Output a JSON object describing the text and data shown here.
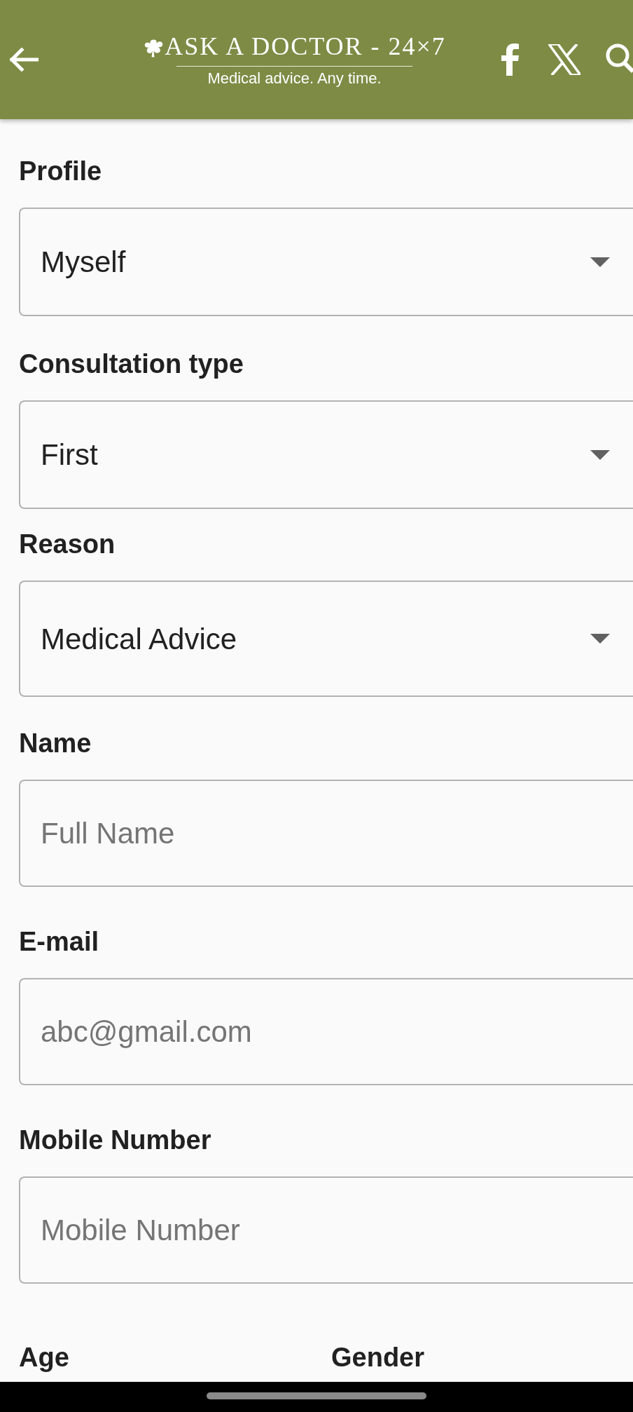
{
  "header": {
    "title": "ASK A DOCTOR - 24×7",
    "tagline": "Medical advice. Any time."
  },
  "form": {
    "fields": [
      {
        "kind": "dropdown",
        "label": "Profile",
        "value": "Myself"
      },
      {
        "kind": "dropdown",
        "label": "Consultation type",
        "value": "First"
      },
      {
        "kind": "dropdown",
        "label": "Reason",
        "value": "Medical Advice"
      },
      {
        "kind": "text",
        "label": "Name",
        "placeholder": "Full Name"
      },
      {
        "kind": "text",
        "label": "E-mail",
        "placeholder": "abc@gmail.com"
      },
      {
        "kind": "text",
        "label": "Mobile Number",
        "placeholder": "Mobile Number"
      }
    ],
    "bottom_labels": [
      "Age",
      "Gender"
    ]
  }
}
